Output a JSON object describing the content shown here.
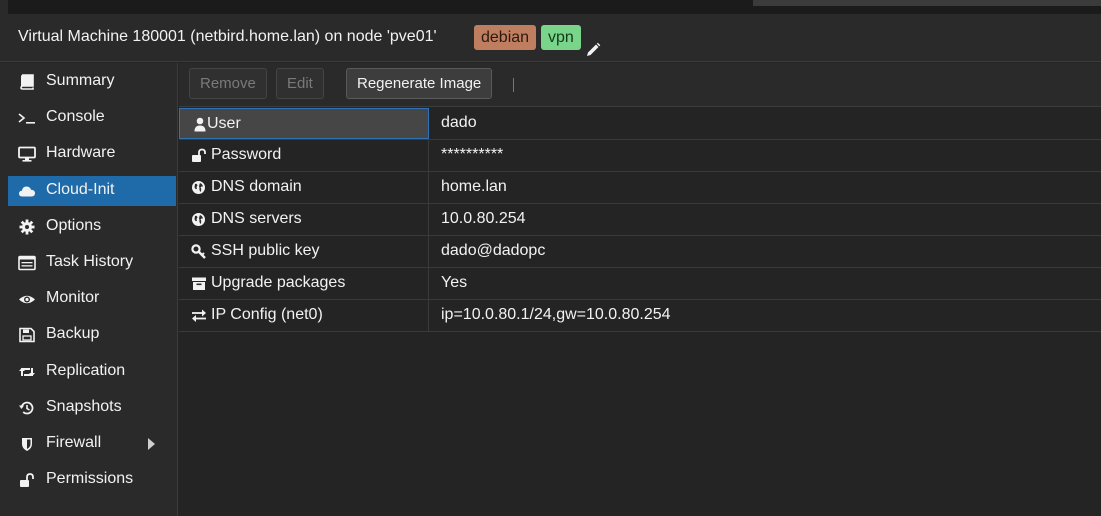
{
  "header": {
    "title": "Virtual Machine 180001 (netbird.home.lan) on node 'pve01'",
    "tags": [
      "debian",
      "vpn"
    ],
    "tag_colors": {
      "debian": "#c07e60",
      "vpn": "#79d58a"
    }
  },
  "sidebar": {
    "items": [
      {
        "label": "Summary",
        "icon": "book-icon"
      },
      {
        "label": "Console",
        "icon": "terminal-icon"
      },
      {
        "label": "Hardware",
        "icon": "desktop-icon"
      },
      {
        "label": "Cloud-Init",
        "icon": "cloud-icon",
        "active": true
      },
      {
        "label": "Options",
        "icon": "gear-icon"
      },
      {
        "label": "Task History",
        "icon": "list-icon"
      },
      {
        "label": "Monitor",
        "icon": "eye-icon"
      },
      {
        "label": "Backup",
        "icon": "floppy-icon"
      },
      {
        "label": "Replication",
        "icon": "retweet-icon"
      },
      {
        "label": "Snapshots",
        "icon": "history-icon"
      },
      {
        "label": "Firewall",
        "icon": "shield-icon"
      },
      {
        "label": "Permissions",
        "icon": "unlock-icon"
      }
    ],
    "accent": "#1f6aa8"
  },
  "toolbar": {
    "remove_label": "Remove",
    "edit_label": "Edit",
    "regenerate_label": "Regenerate Image"
  },
  "grid": {
    "rows": [
      {
        "key": "User",
        "value": "dado",
        "icon": "user-icon"
      },
      {
        "key": "Password",
        "value": "**********",
        "icon": "unlock-icon"
      },
      {
        "key": "DNS domain",
        "value": "home.lan",
        "icon": "globe-icon"
      },
      {
        "key": "DNS servers",
        "value": "10.0.80.254",
        "icon": "globe-icon"
      },
      {
        "key": "SSH public key",
        "value": "dado@dadopc",
        "icon": "key-icon"
      },
      {
        "key": "Upgrade packages",
        "value": "Yes",
        "icon": "archive-icon"
      },
      {
        "key": "IP Config (net0)",
        "value": "ip=10.0.80.1/24,gw=10.0.80.254",
        "icon": "exchange-icon"
      }
    ]
  }
}
